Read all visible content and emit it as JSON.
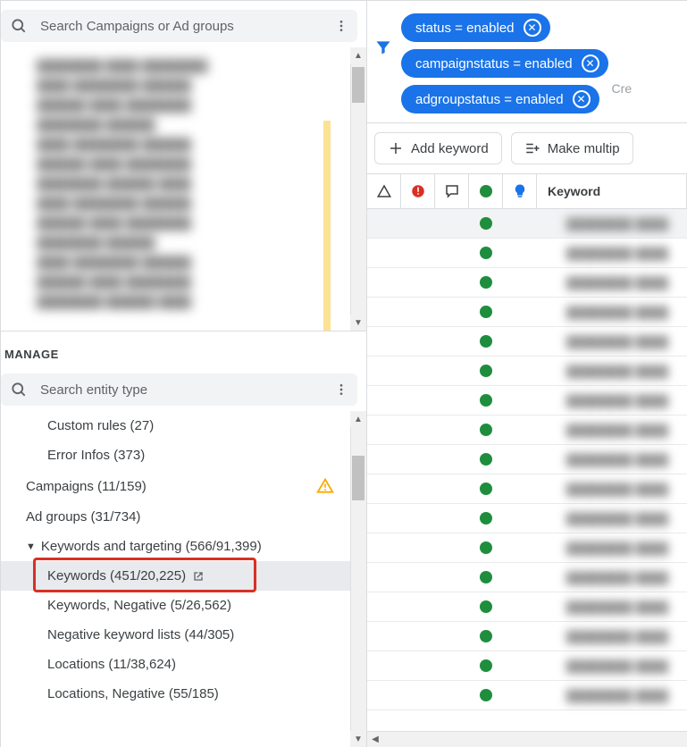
{
  "left": {
    "search_campaigns_placeholder": "Search Campaigns or Ad groups",
    "manage_label": "MANAGE",
    "search_entity_placeholder": "Search entity type",
    "entities": [
      {
        "label": "Custom rules (27)",
        "indent": 2
      },
      {
        "label": "Error Infos (373)",
        "indent": 2
      },
      {
        "label": "Campaigns (11/159)",
        "indent": 1,
        "warn": true
      },
      {
        "label": "Ad groups (31/734)",
        "indent": 1
      },
      {
        "label": "Keywords and targeting (566/91,399)",
        "indent": 1,
        "expandable": true
      },
      {
        "label": "Keywords (451/20,225)",
        "indent": 2,
        "selected": true,
        "popout": true
      },
      {
        "label": "Keywords, Negative (5/26,562)",
        "indent": 2
      },
      {
        "label": "Negative keyword lists (44/305)",
        "indent": 2
      },
      {
        "label": "Locations (11/38,624)",
        "indent": 2
      },
      {
        "label": "Locations, Negative (55/185)",
        "indent": 2
      }
    ]
  },
  "right": {
    "chips": [
      "status = enabled",
      "campaignstatus = enabled",
      "adgroupstatus = enabled"
    ],
    "create_hint": "Cre",
    "add_keyword_label": "Add keyword",
    "make_multiple_label": "Make multip",
    "keyword_header": "Keyword",
    "row_count": 17
  }
}
